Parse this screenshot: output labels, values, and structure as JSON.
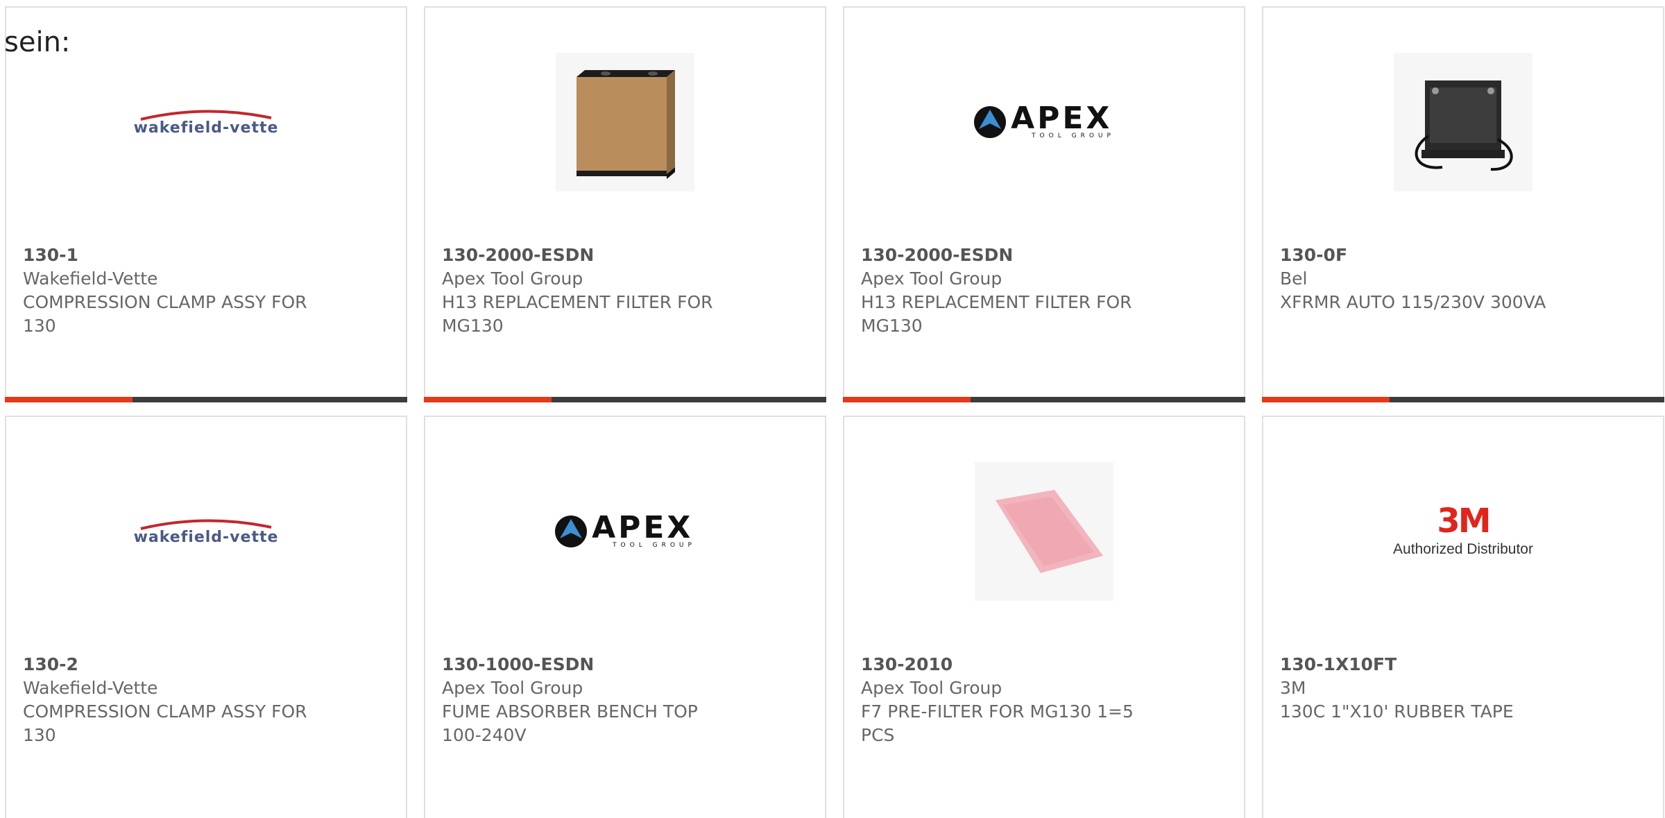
{
  "prefix_text": "sein:",
  "colors": {
    "accent": "#e8381a",
    "bar": "#3c3c3c",
    "text": "#666666"
  },
  "products": [
    {
      "sku": "130-1",
      "manufacturer": "Wakefield-Vette",
      "desc_line1": "COMPRESSION CLAMP ASSY FOR",
      "desc_line2": "130",
      "image": "wakefield-vette-logo",
      "logo_text": "wakefield-vette"
    },
    {
      "sku": "130-2000-ESDN",
      "manufacturer": "Apex Tool Group",
      "desc_line1": "H13 REPLACEMENT FILTER FOR",
      "desc_line2": "MG130",
      "image": "filter-box-photo"
    },
    {
      "sku": "130-2000-ESDN",
      "manufacturer": "Apex Tool Group",
      "desc_line1": "H13 REPLACEMENT FILTER FOR",
      "desc_line2": "MG130",
      "image": "apex-logo",
      "logo_text": "APEX",
      "logo_subtext": "TOOL GROUP"
    },
    {
      "sku": "130-0F",
      "manufacturer": "Bel",
      "desc_line1": "XFRMR AUTO 115/230V 300VA",
      "desc_line2": "",
      "image": "transformer-photo"
    },
    {
      "sku": "130-2",
      "manufacturer": "Wakefield-Vette",
      "desc_line1": "COMPRESSION CLAMP ASSY FOR",
      "desc_line2": "130",
      "image": "wakefield-vette-logo",
      "logo_text": "wakefield-vette"
    },
    {
      "sku": "130-1000-ESDN",
      "manufacturer": "Apex Tool Group",
      "desc_line1": "FUME ABSORBER BENCH TOP",
      "desc_line2": "100-240V",
      "image": "apex-logo",
      "logo_text": "APEX",
      "logo_subtext": "TOOL GROUP"
    },
    {
      "sku": "130-2010",
      "manufacturer": "Apex Tool Group",
      "desc_line1": "F7 PRE-FILTER FOR MG130 1=5",
      "desc_line2": "PCS",
      "image": "pink-filter-photo"
    },
    {
      "sku": "130-1X10FT",
      "manufacturer": "3M",
      "desc_line1": "130C 1\"X10' RUBBER TAPE",
      "desc_line2": "",
      "image": "3m-logo",
      "logo_text": "3M",
      "logo_subtext": "Authorized Distributor"
    }
  ]
}
